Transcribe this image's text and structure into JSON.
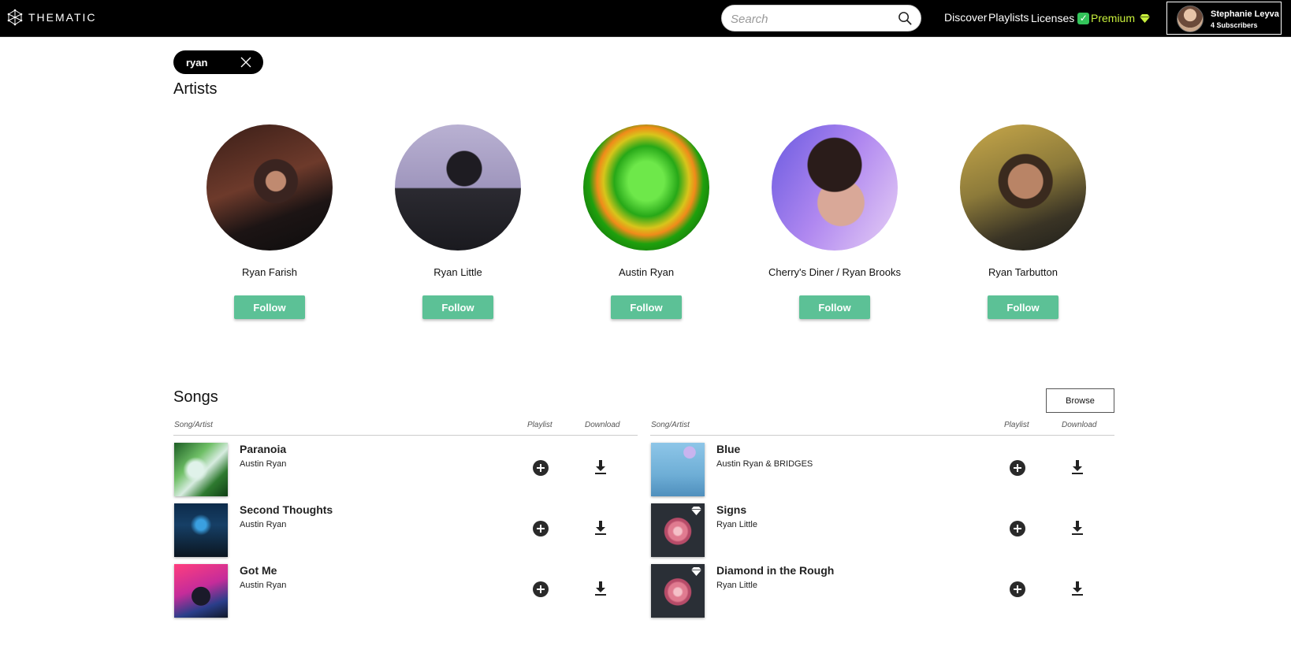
{
  "header": {
    "logo_text": "THEMATIC",
    "search": {
      "placeholder": "Search",
      "value": ""
    },
    "nav": {
      "discover": "Discover",
      "playlists": "Playlists",
      "licenses": "Licenses",
      "premium": "Premium"
    },
    "user": {
      "name": "Stephanie Leyva",
      "subscribers": "4 Subscribers"
    },
    "colors": {
      "premium": "#c8f03c",
      "licenses_badge": "#33c45a"
    }
  },
  "query_chip": {
    "text": "ryan"
  },
  "artists": {
    "title": "Artists",
    "follow_label": "Follow",
    "follow_color": "#5cc196",
    "items": [
      {
        "name": "Ryan Farish"
      },
      {
        "name": "Ryan Little"
      },
      {
        "name": "Austin Ryan"
      },
      {
        "name": "Cherry's Diner / Ryan Brooks"
      },
      {
        "name": "Ryan Tarbutton"
      }
    ]
  },
  "songs": {
    "title": "Songs",
    "browse_label": "Browse",
    "headers": {
      "song_artist": "Song/Artist",
      "playlist": "Playlist",
      "download": "Download"
    },
    "left": [
      {
        "title": "Paranoia",
        "artist": "Austin Ryan",
        "premium": false
      },
      {
        "title": "Second Thoughts",
        "artist": "Austin Ryan",
        "premium": false
      },
      {
        "title": "Got Me",
        "artist": "Austin Ryan",
        "premium": false
      }
    ],
    "right": [
      {
        "title": "Blue",
        "artist": "Austin Ryan & BRIDGES",
        "premium": false
      },
      {
        "title": "Signs",
        "artist": "Ryan Little",
        "premium": true
      },
      {
        "title": "Diamond in the Rough",
        "artist": "Ryan Little",
        "premium": true
      }
    ]
  }
}
